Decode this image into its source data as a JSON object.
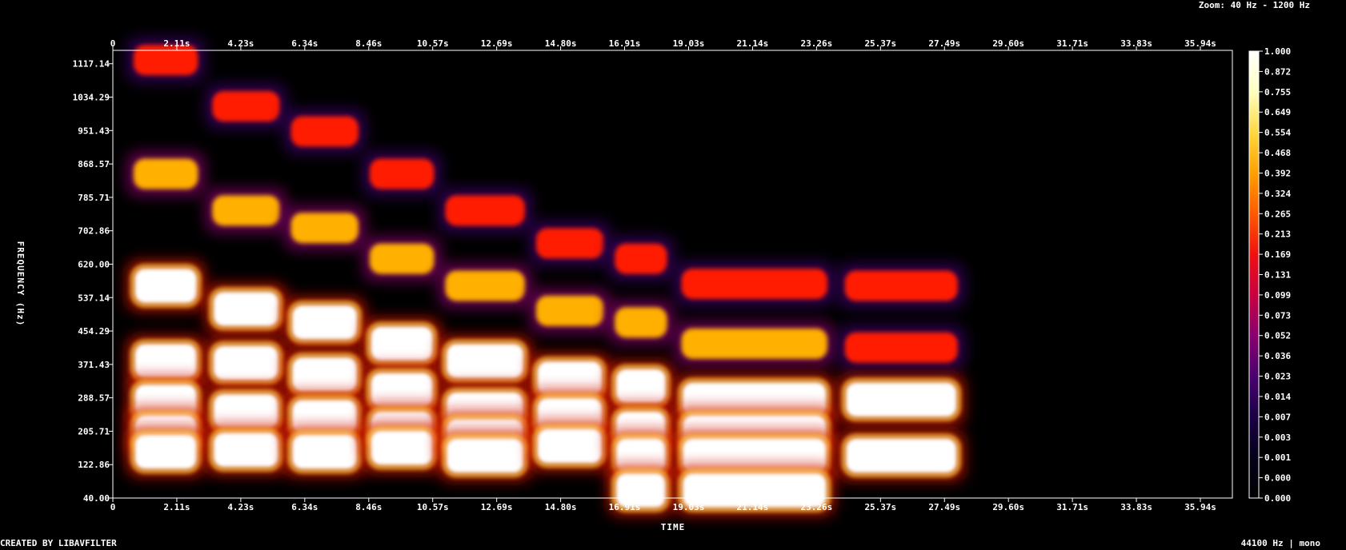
{
  "header": {
    "zoom": "Zoom: 40 Hz - 1200 Hz"
  },
  "footer": {
    "credit": "CREATED BY LIBAVFILTER",
    "format": "44100 Hz | mono"
  },
  "colors": {
    "background": "#000000",
    "axis": "#ffffff",
    "colormap": [
      "#000000",
      "#05001a",
      "#1a0045",
      "#4a0070",
      "#8a0070",
      "#c80040",
      "#f01010",
      "#ff5a00",
      "#ffa000",
      "#ffd840",
      "#ffffc0",
      "#ffffff"
    ]
  },
  "chart_data": {
    "type": "heatmap",
    "subtype": "spectrogram",
    "xlabel": "TIME",
    "ylabel": "FREQUENCY (Hz)",
    "xlim_seconds": [
      0,
      36.99
    ],
    "ylim_hz": [
      40,
      1200
    ],
    "x_ticks": [
      "0",
      "2.11s",
      "4.23s",
      "6.34s",
      "8.46s",
      "10.57s",
      "12.69s",
      "14.80s",
      "16.91s",
      "19.03s",
      "21.14s",
      "23.26s",
      "25.37s",
      "27.49s",
      "29.60s",
      "31.71s",
      "33.83s",
      "35.94s"
    ],
    "y_ticks": [
      "1117.14",
      "1034.29",
      "951.43",
      "868.57",
      "785.71",
      "702.86",
      "620.00",
      "537.14",
      "454.29",
      "371.43",
      "288.57",
      "205.71",
      "122.86",
      "40.00"
    ],
    "colorbar_ticks": [
      "1.000",
      "0.872",
      "0.755",
      "0.649",
      "0.554",
      "0.468",
      "0.392",
      "0.324",
      "0.265",
      "0.213",
      "0.169",
      "0.131",
      "0.099",
      "0.073",
      "0.052",
      "0.036",
      "0.023",
      "0.014",
      "0.007",
      "0.003",
      "0.001",
      "0.000",
      "0.000"
    ],
    "segments": [
      {
        "t": [
          0.5,
          3.0
        ],
        "bands": [
          [
            1175,
            0.3
          ],
          [
            880,
            0.55
          ],
          [
            590,
            1.0
          ],
          [
            395,
            1.0
          ],
          [
            290,
            1.0
          ],
          [
            210,
            1.0
          ],
          [
            160,
            1.0
          ]
        ]
      },
      {
        "t": [
          3.1,
          5.7
        ],
        "bands": [
          [
            1055,
            0.28
          ],
          [
            785,
            0.55
          ],
          [
            530,
            1.0
          ],
          [
            390,
            1.0
          ],
          [
            265,
            1.0
          ],
          [
            165,
            1.0
          ]
        ]
      },
      {
        "t": [
          5.7,
          8.3
        ],
        "bands": [
          [
            990,
            0.28
          ],
          [
            740,
            0.5
          ],
          [
            495,
            1.0
          ],
          [
            360,
            1.0
          ],
          [
            250,
            1.0
          ],
          [
            160,
            1.0
          ]
        ]
      },
      {
        "t": [
          8.3,
          10.8
        ],
        "bands": [
          [
            880,
            0.28
          ],
          [
            660,
            0.5
          ],
          [
            440,
            1.0
          ],
          [
            320,
            1.0
          ],
          [
            220,
            1.0
          ],
          [
            170,
            1.0
          ]
        ]
      },
      {
        "t": [
          10.8,
          13.8
        ],
        "bands": [
          [
            785,
            0.28
          ],
          [
            590,
            0.5
          ],
          [
            395,
            1.0
          ],
          [
            270,
            1.0
          ],
          [
            200,
            1.0
          ],
          [
            150,
            1.0
          ]
        ]
      },
      {
        "t": [
          13.8,
          16.4
        ],
        "bands": [
          [
            700,
            0.28
          ],
          [
            525,
            0.5
          ],
          [
            350,
            1.0
          ],
          [
            255,
            1.0
          ],
          [
            175,
            1.0
          ]
        ]
      },
      {
        "t": [
          16.4,
          18.5
        ],
        "bands": [
          [
            660,
            0.28
          ],
          [
            495,
            0.5
          ],
          [
            330,
            1.0
          ],
          [
            220,
            1.0
          ],
          [
            150,
            1.0
          ],
          [
            60,
            1.0
          ]
        ]
      },
      {
        "t": [
          18.6,
          23.8
        ],
        "bands": [
          [
            595,
            0.28
          ],
          [
            440,
            0.5
          ],
          [
            295,
            1.0
          ],
          [
            210,
            1.0
          ],
          [
            150,
            1.0
          ],
          [
            60,
            1.0
          ]
        ]
      },
      {
        "t": [
          24.0,
          28.1
        ],
        "bands": [
          [
            590,
            0.22
          ],
          [
            430,
            0.35
          ],
          [
            295,
            1.0
          ],
          [
            150,
            1.0
          ]
        ]
      }
    ]
  }
}
